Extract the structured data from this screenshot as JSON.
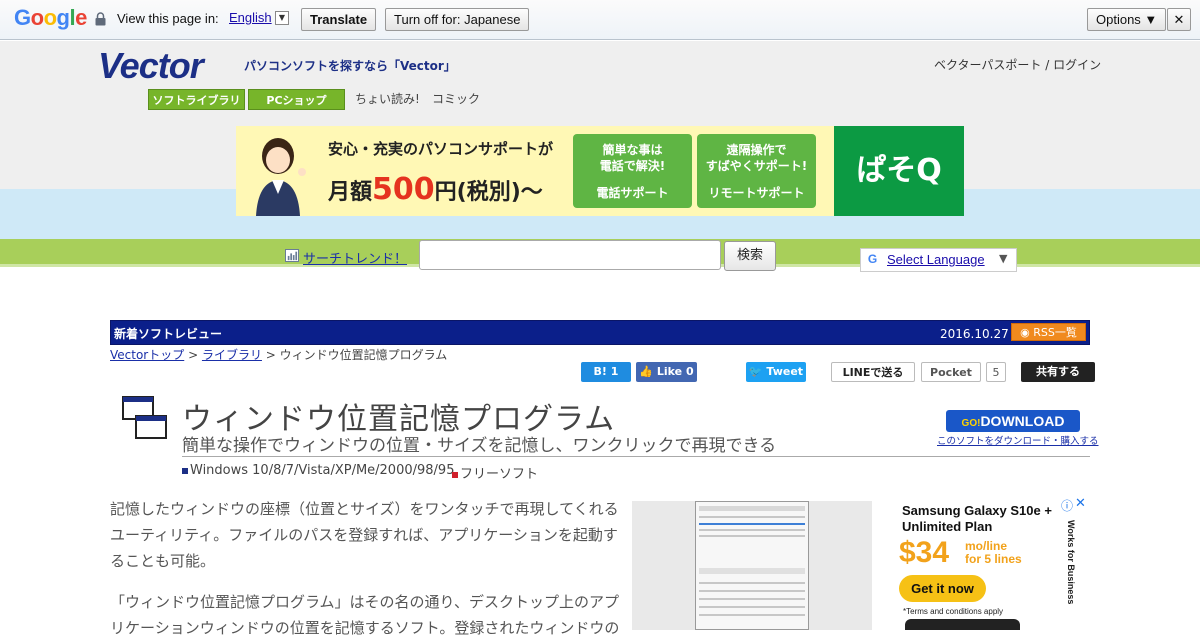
{
  "translate_bar": {
    "logo": [
      "G",
      "o",
      "o",
      "g",
      "l",
      "e"
    ],
    "logo_colors": [
      "#4285f4",
      "#ea4335",
      "#fbbc05",
      "#4285f4",
      "#34a853",
      "#ea4335"
    ],
    "prompt": "View this page in:",
    "language": "English",
    "translate_label": "Translate",
    "turn_off_label": "Turn off for: Japanese",
    "options_label": "Options ▼",
    "close_label": "✕"
  },
  "header": {
    "logo": "Vector",
    "tagline": "パソコンソフトを探すなら「Vector」",
    "login": "ベクターパスポート / ログイン",
    "nav": {
      "software_library": "ソフトライブラリ",
      "pc_shop": "PCショップ",
      "light_read": "ちょい読み!",
      "comic": "コミック"
    }
  },
  "banner": {
    "line1": "安心・充実のパソコンサポートが",
    "line2_pre": "月額",
    "price": "500",
    "line2_post": "円(税別)〜",
    "box1_top": "簡単な事は\n電話で解決!",
    "box1_bottom": "電話サポート",
    "box2_top": "遠隔操作で\nすばやくサポート!",
    "box2_bottom": "リモートサポート",
    "brand": "ぱそQ"
  },
  "search": {
    "trend_link": "サーチトレンド！",
    "button": "検索",
    "placeholder": "",
    "select_language": "Select Language",
    "select_arrow": "▼"
  },
  "section": {
    "title": "新着ソフトレビュー",
    "date": "2016.10.27",
    "rss": "RSS一覧"
  },
  "breadcrumb": {
    "top": "Vectorトップ",
    "sep1": " > ",
    "library": "ライブラリ",
    "sep2": " > ",
    "current": "ウィンドウ位置記憶プログラム"
  },
  "share": {
    "hatena": "B! 1",
    "facebook": "👍 Like 0",
    "twitter": "🐦 Tweet",
    "line": "LINEで送る",
    "pocket": "Pocket",
    "pocket_count": "5",
    "share_all": "共有する"
  },
  "app": {
    "title": "ウィンドウ位置記憶プログラム",
    "subtitle": "簡単な操作でウィンドウの位置・サイズを記憶し、ワンクリックで再現できる",
    "os": "Windows 10/8/7/Vista/XP/Me/2000/98/95",
    "license": "フリーソフト",
    "download_go": "GO!",
    "download_label": "DOWNLOAD",
    "download_link": "このソフトをダウンロード・購入する"
  },
  "body": {
    "para1": "記憶したウィンドウの座標（位置とサイズ）をワンタッチで再現してくれるユーティリティ。ファイルのパスを登録すれば、アプリケーションを起動することも可能。",
    "para2": "「ウィンドウ位置記憶プログラム」はその名の通り、デスクトップ上のアプリケーションウィンドウの位置を記憶するソフト。登録されたウィンドウの"
  },
  "ad": {
    "title": "Samsung Galaxy S10e + Unlimited Plan",
    "price": "$34",
    "per": "mo/line\nfor 5 lines",
    "cta": "Get it now",
    "terms": "*Terms and conditions apply",
    "vertical": "Works for Business",
    "info": "ⓘ",
    "close": "✕"
  },
  "colors": {
    "brand_blue": "#1c2f86",
    "nav_green": "#77b52a",
    "section_blue": "#0b1f8a",
    "ad_orange": "#f2a21b"
  }
}
